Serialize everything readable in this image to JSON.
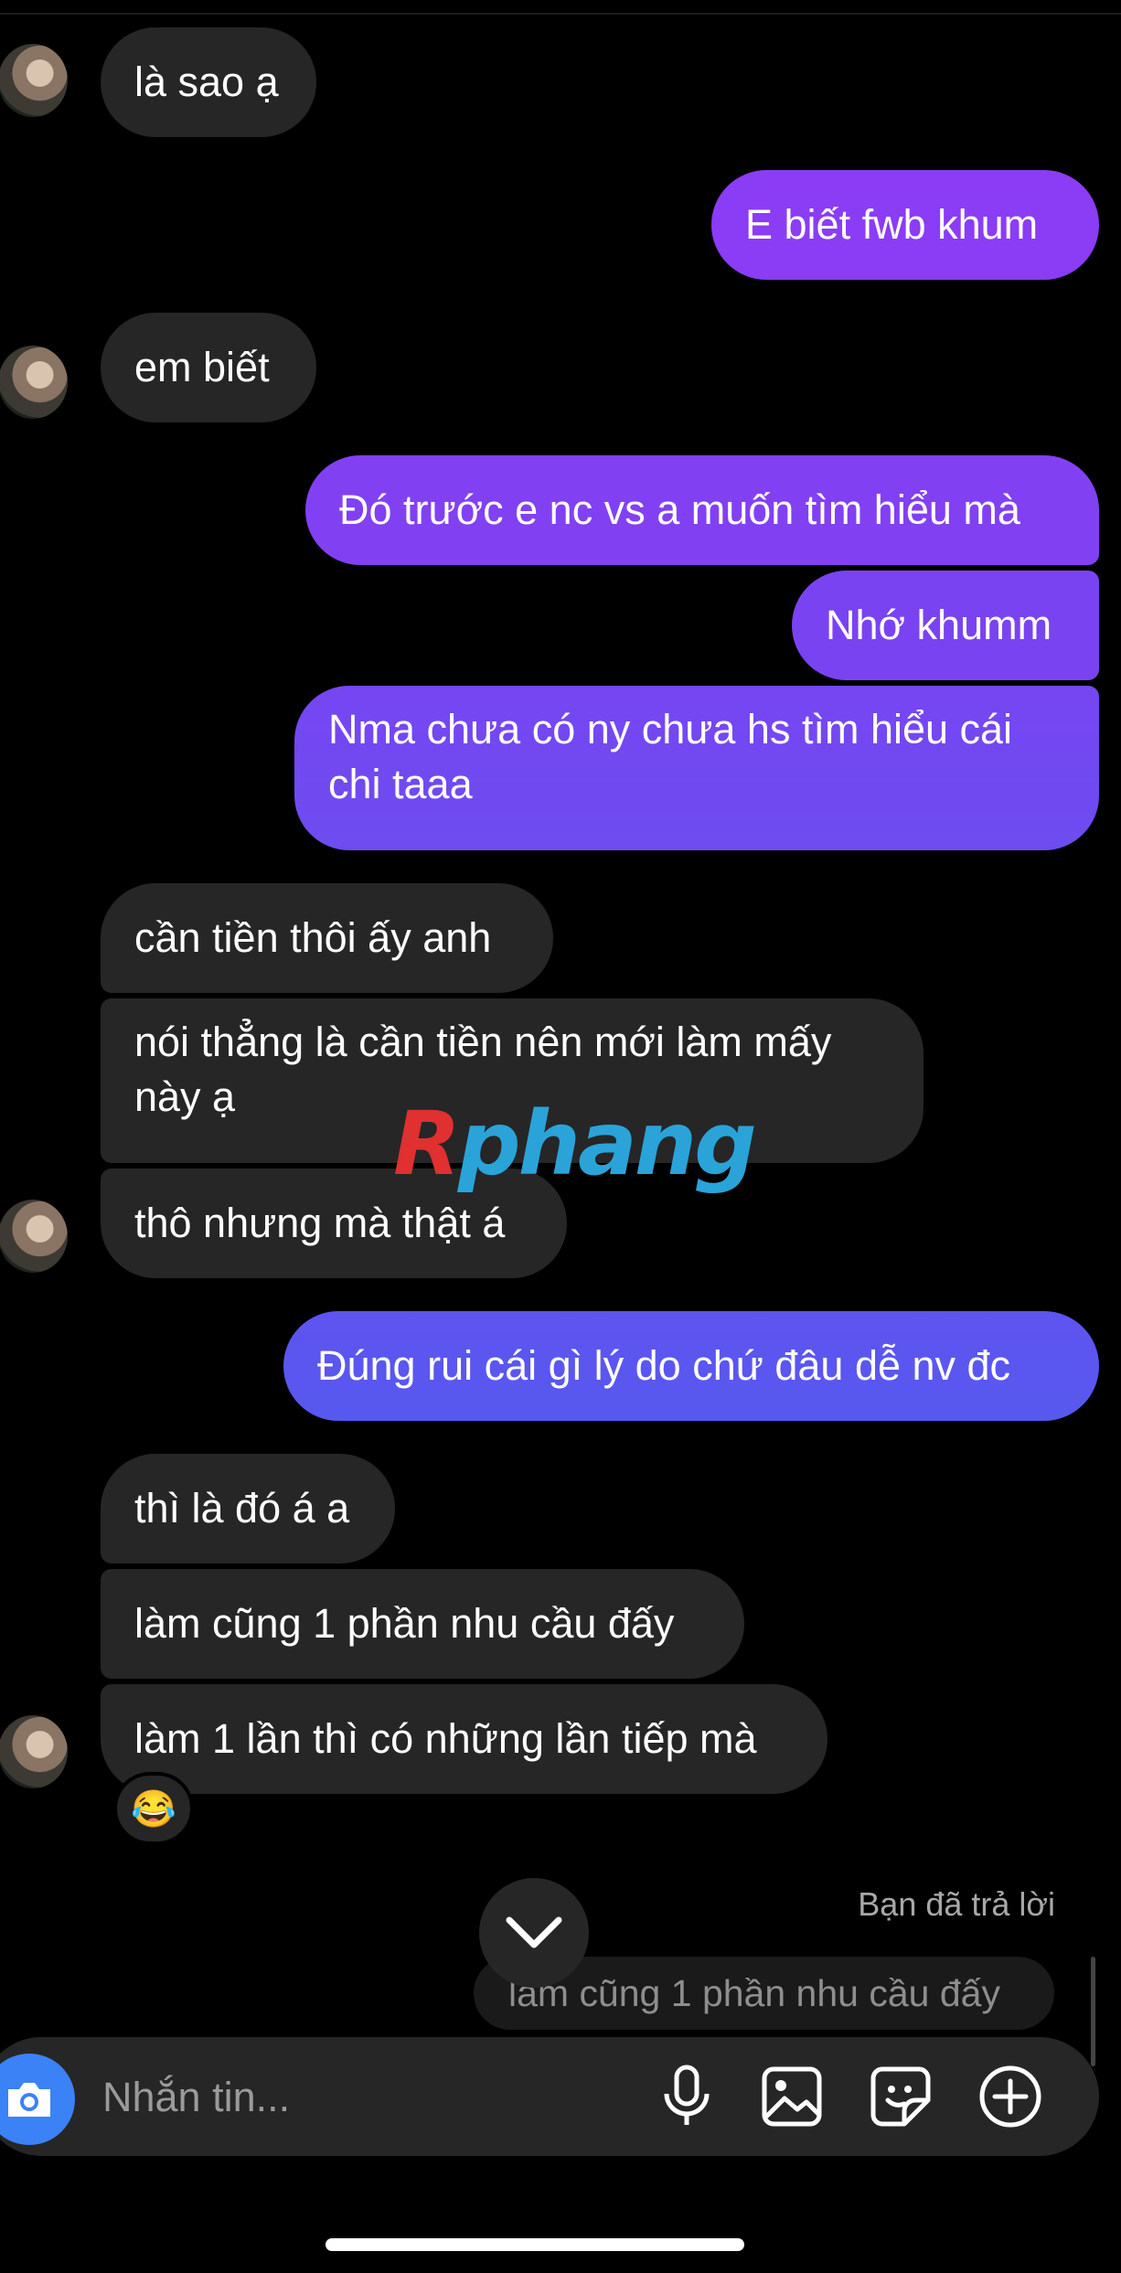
{
  "colors": {
    "background": "#000000",
    "received_bubble": "#262626",
    "sent_gradient_top": "#8b3cf5",
    "sent_gradient_bottom": "#4a5bf0",
    "camera_button": "#3b82f6"
  },
  "messages": [
    {
      "side": "received",
      "text": "là sao ạ"
    },
    {
      "side": "sent",
      "text": "E biết fwb khum"
    },
    {
      "side": "received",
      "text": "em biết"
    },
    {
      "side": "sent",
      "text": "Đó trước e nc vs a muốn tìm hiểu mà"
    },
    {
      "side": "sent",
      "text": "Nhớ khumm"
    },
    {
      "side": "sent",
      "text": "Nma chưa có ny chưa hs tìm hiểu cái chi taaa"
    },
    {
      "side": "received",
      "text": "cần tiền thôi ấy anh"
    },
    {
      "side": "received",
      "text": "nói thẳng là cần tiền nên mới làm mấy này ạ"
    },
    {
      "side": "received",
      "text": "thô nhưng mà thật á"
    },
    {
      "side": "sent",
      "text": "Đúng rui cái gì lý do chứ đâu dễ nv đc"
    },
    {
      "side": "received",
      "text": "thì là đó á a"
    },
    {
      "side": "received",
      "text": "làm cũng 1 phần nhu cầu đấy"
    },
    {
      "side": "received",
      "text": "làm 1 lần thì có những lần tiếp mà"
    }
  ],
  "reaction": {
    "emoji": "😂"
  },
  "watermark": {
    "part1": "R",
    "part2": "phang"
  },
  "reply": {
    "label": "Bạn đã trả lời",
    "quoted": "làm cũng 1 phần nhu cầu đấy"
  },
  "composer": {
    "placeholder": "Nhắn tin...",
    "icons": [
      "camera-icon",
      "microphone-icon",
      "image-icon",
      "sticker-icon",
      "plus-icon"
    ]
  }
}
